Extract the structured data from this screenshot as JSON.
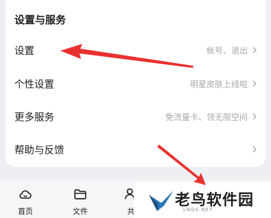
{
  "section": {
    "title": "设置与服务"
  },
  "rows": [
    {
      "label": "设置",
      "value": "帐号、退出"
    },
    {
      "label": "个性设置",
      "value": "明星皮肤上线啦"
    },
    {
      "label": "更多服务",
      "value": "免流量卡、领无限空间"
    },
    {
      "label": "帮助与反馈",
      "value": ""
    }
  ],
  "tabbar": {
    "tabs": [
      {
        "label": "首页",
        "icon": "cloud-home-icon"
      },
      {
        "label": "文件",
        "icon": "folder-icon"
      },
      {
        "label": "共",
        "icon": "share-icon"
      }
    ]
  },
  "watermark": {
    "text": "老鸟软件园",
    "sub": "LNQS.NET"
  },
  "colors": {
    "annotation_arrow": "#e8312f",
    "accent_badge": "#e5484d",
    "muted_text": "#a4a7ad"
  }
}
